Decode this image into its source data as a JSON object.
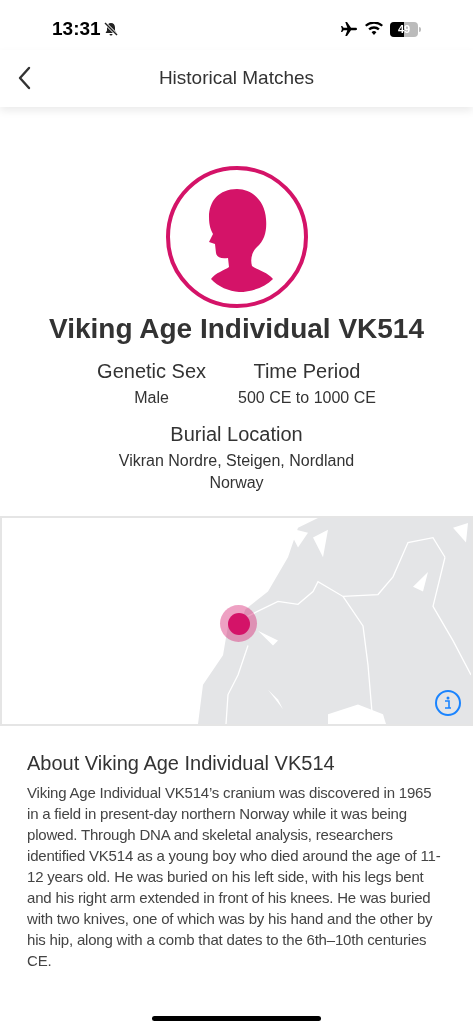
{
  "status_bar": {
    "time": "13:31",
    "silent": true,
    "airplane_mode": true,
    "battery": "49"
  },
  "nav": {
    "title": "Historical Matches"
  },
  "match": {
    "name": "Viking Age Individual VK514",
    "facts": [
      {
        "label": "Genetic Sex",
        "value": "Male"
      },
      {
        "label": "Time Period",
        "value": "500 CE to 1000 CE"
      }
    ],
    "burial": {
      "label": "Burial Location",
      "lines": [
        "Vikran Nordre, Steigen, Nordland",
        "Norway"
      ]
    }
  },
  "about": {
    "heading": "About Viking Age Individual VK514",
    "text": "Viking Age Individual VK514’s cranium was discovered in 1965 in a field in present-day northern Norway while it was being plowed. Through DNA and skeletal analysis, researchers identified VK514 as a young boy who died around the age of 11-12 years old. He was buried on his left side, with his legs bent and his right arm extended in front of his knees. He was buried with two knives, one of which was by his hand and the other by his hip, along with a comb that dates to the 6th–10th centuries CE."
  }
}
